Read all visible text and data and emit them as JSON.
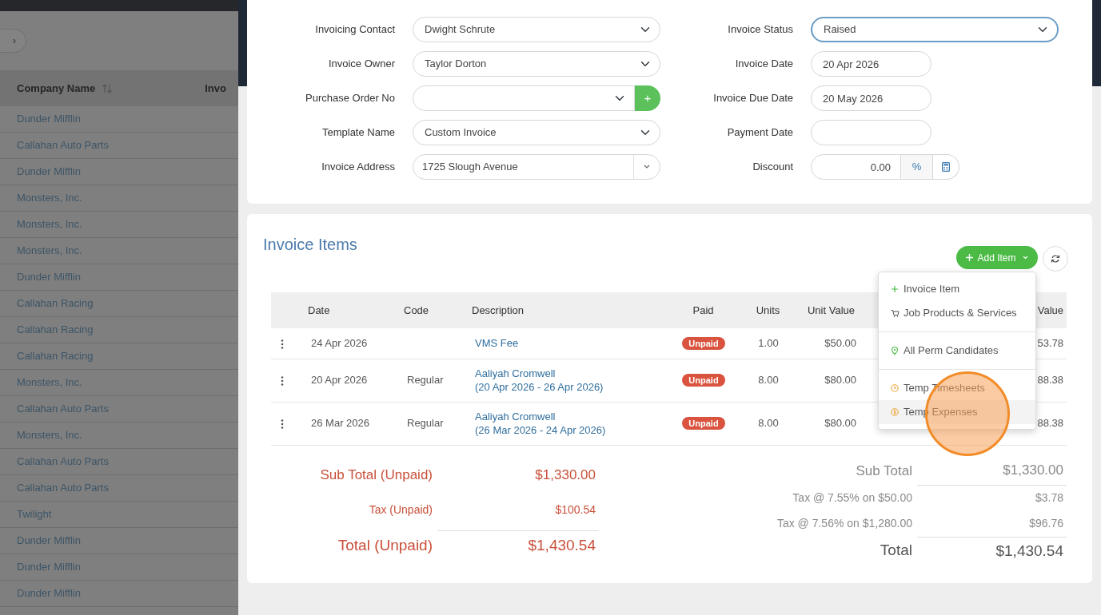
{
  "background_list": {
    "pager_next": "›",
    "columns": [
      "Company Name",
      "Invo"
    ],
    "rows": [
      "Dunder Mifflin",
      "Callahan Auto Parts",
      "Dunder Mifflin",
      "Monsters, Inc.",
      "Monsters, Inc.",
      "Monsters, Inc.",
      "Dunder Mifflin",
      "Callahan Racing",
      "Callahan Racing",
      "Callahan Racing",
      "Monsters, Inc.",
      "Callahan Auto Parts",
      "Monsters, Inc.",
      "Callahan Auto Parts",
      "Callahan Auto Parts",
      "Twilight",
      "Dunder Mifflin",
      "Dunder Mifflin",
      "Dunder Mifflin"
    ]
  },
  "invoice_form": {
    "left": [
      {
        "label": "Invoicing Contact",
        "kind": "select",
        "value": "Dwight Schrute",
        "focused": false
      },
      {
        "label": "Invoice Owner",
        "kind": "select",
        "value": "Taylor Dorton",
        "focused": false
      },
      {
        "label": "Purchase Order No",
        "kind": "select_add",
        "add_symbol": "+",
        "focused": false
      },
      {
        "label": "Template Name",
        "kind": "select",
        "value": "Custom Invoice",
        "focused": false
      },
      {
        "label": "Invoice Address",
        "kind": "combo",
        "value": "1725 Slough Avenue",
        "focused": false
      }
    ],
    "right": [
      {
        "label": "Invoice Status",
        "kind": "select",
        "value": "Raised",
        "focused": true
      },
      {
        "label": "Invoice Date",
        "kind": "date",
        "value": "20 Apr 2026",
        "focused": false
      },
      {
        "label": "Invoice Due Date",
        "kind": "date",
        "value": "20 May 2026",
        "focused": false
      },
      {
        "label": "Payment Date",
        "kind": "date",
        "focused": false
      },
      {
        "label": "Discount",
        "kind": "discount",
        "value": "0.00",
        "unit": "%",
        "focused": false
      }
    ]
  },
  "invoice_items": {
    "title": "Invoice Items",
    "add_button": "Add Item",
    "menu": [
      [
        {
          "label": "Invoice Item",
          "kind": "add",
          "selected": false
        },
        {
          "label": "Job Products & Services",
          "kind": "cart",
          "selected": false
        }
      ],
      [
        {
          "label": "All Perm Candidates",
          "kind": "pin",
          "selected": false
        }
      ],
      [
        {
          "label": "Temp Timesheets",
          "kind": "clock",
          "selected": false
        },
        {
          "label": "Temp Expenses",
          "kind": "coin",
          "selected": true
        }
      ]
    ],
    "table": {
      "columns": [
        "Date",
        "Code",
        "Description",
        "Paid",
        "Units",
        "Unit Value",
        "Value"
      ],
      "rows": [
        {
          "date": "24 Apr 2026",
          "description": "VMS Fee",
          "paid": false,
          "paid_label": "Unpaid",
          "units": "1.00",
          "unit_value": "$50.00",
          "column_7": "53.78"
        },
        {
          "date": "20 Apr 2026",
          "code": "Regular",
          "description": "Aaliyah Cromwell",
          "period": "(20 Apr 2026 - 26 Apr 2026)",
          "paid": false,
          "paid_label": "Unpaid",
          "units": "8.00",
          "unit_value": "$80.00",
          "column_7": "88.38"
        },
        {
          "date": "26 Mar 2026",
          "code": "Regular",
          "description": "Aaliyah Cromwell",
          "period": "(26 Mar 2026 - 24 Apr 2026)",
          "paid": false,
          "paid_label": "Unpaid",
          "units": "8.00",
          "unit_value": "$80.00",
          "column_7": "88.38"
        }
      ]
    },
    "totals": [
      {
        "kind": "unpaid",
        "rows": [
          {
            "kind": "sub",
            "label": "Sub Total (Unpaid)",
            "value": "$1,330.00"
          },
          {
            "kind": "tax",
            "label": "Tax (Unpaid)",
            "value": "$100.54"
          },
          {
            "kind": "total",
            "label": "Total (Unpaid)",
            "value": "$1,430.54"
          }
        ]
      },
      {
        "kind": "all",
        "rows": [
          {
            "kind": "sub",
            "label": "Sub Total",
            "value": "$1,330.00"
          },
          {
            "kind": "tax",
            "label": "Tax @ 7.55% on $50.00",
            "value": "$3.78"
          },
          {
            "kind": "tax",
            "label": "Tax @ 7.56% on $1,280.00",
            "value": "$96.76"
          },
          {
            "kind": "total",
            "label": "Total",
            "value": "$1,430.54"
          }
        ]
      }
    ]
  }
}
